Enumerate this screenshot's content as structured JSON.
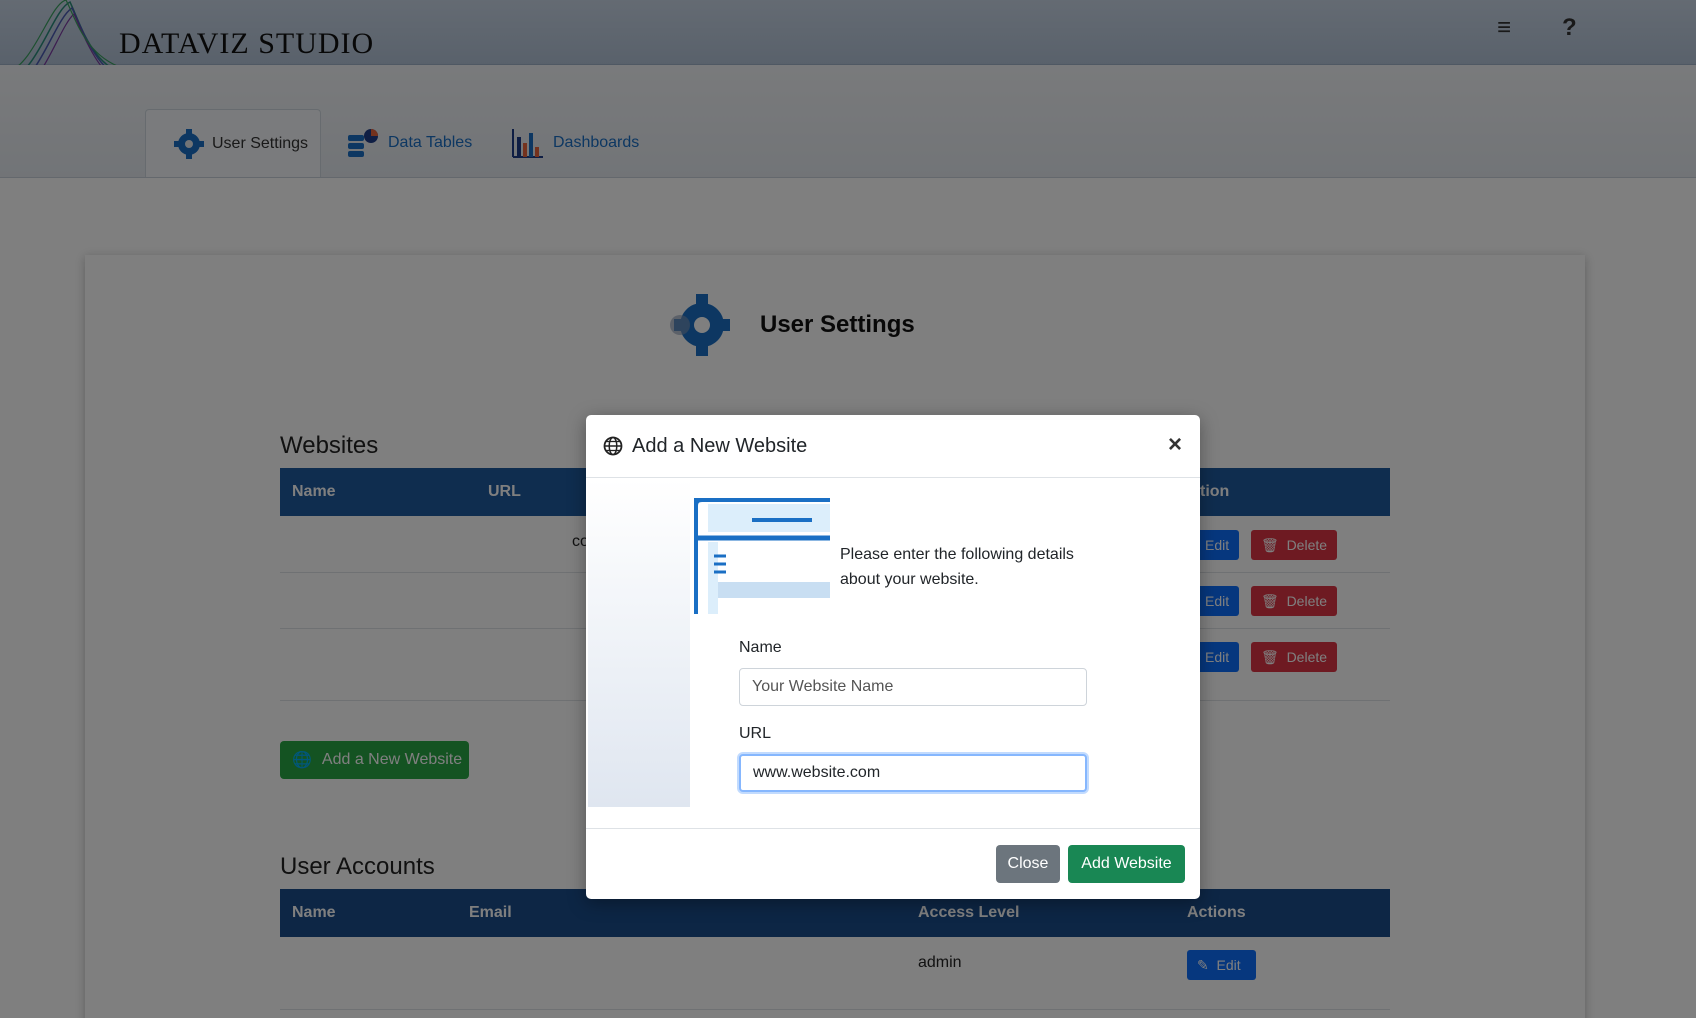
{
  "app": {
    "brand": "DATAVIZ STUDIO"
  },
  "header": {
    "menu_icon": "menu-icon",
    "help_icon": "help-icon",
    "menu_glyph": "≡",
    "help_glyph": "?"
  },
  "tabs": [
    {
      "label": "User Settings",
      "icon": "gear-icon",
      "active": true
    },
    {
      "label": "Data Tables",
      "icon": "database-icon",
      "active": false
    },
    {
      "label": "Dashboards",
      "icon": "bar-chart-icon",
      "active": false
    }
  ],
  "page": {
    "title": "User Settings"
  },
  "websites": {
    "title": "Websites",
    "columns": {
      "name": "Name",
      "url": "URL",
      "actions_fragment": "tion"
    },
    "row_fragment": "co",
    "edit_label": "Edit",
    "delete_label": "Delete",
    "add_button": "Add a New Website"
  },
  "accounts": {
    "title": "User Accounts",
    "columns": {
      "name": "Name",
      "email": "Email",
      "access": "Access Level",
      "actions": "Actions"
    },
    "rows": [
      {
        "access": "admin",
        "edit": "Edit"
      }
    ]
  },
  "modal": {
    "title": "Add a New Website",
    "close_glyph": "×",
    "description": "Please enter the following details about your website.",
    "name_label": "Name",
    "name_placeholder": "Your Website Name",
    "url_label": "URL",
    "url_value": "www.website.com",
    "close_button": "Close",
    "submit_button": "Add Website"
  }
}
